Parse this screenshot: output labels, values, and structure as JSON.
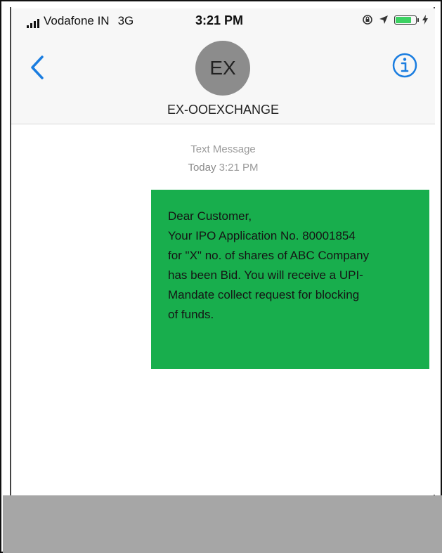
{
  "status_bar": {
    "carrier": "Vodafone IN",
    "network": "3G",
    "time": "3:21 PM"
  },
  "header": {
    "avatar_initials": "EX",
    "contact_name": "EX-OOEXCHANGE"
  },
  "thread": {
    "message_type": "Text Message",
    "timestamp_day": "Today",
    "timestamp_time": "3:21 PM",
    "message_lines": [
      "Dear Customer,",
      "Your IPO Application No. 80001854",
      "for \"X\" no. of shares of ABC Company",
      "has been Bid. You will receive a UPI-",
      "Mandate collect request for blocking",
      "of funds."
    ]
  },
  "colors": {
    "accent": "#1a7de0",
    "bubble": "#18ae4d",
    "avatar": "#8c8c8c",
    "bottom_bar": "#a6a6a6",
    "battery": "#3cd162"
  },
  "icons": {
    "back": "chevron-left-icon",
    "info": "info-icon",
    "location": "location-arrow-icon",
    "rotation_lock": "rotation-lock-icon",
    "charging": "charging-bolt-icon"
  }
}
